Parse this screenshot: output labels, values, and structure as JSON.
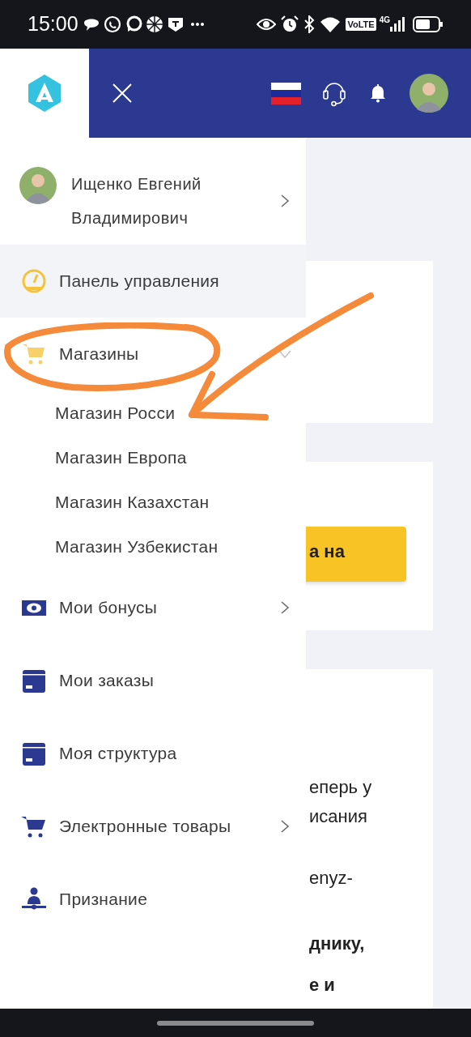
{
  "status_bar": {
    "time": "15:00",
    "volte": "VoLTE",
    "network": "4G"
  },
  "user": {
    "name": "Ищенко Евгений Владимирович",
    "has_submenu": true
  },
  "menu": [
    {
      "label": "Панель управления",
      "selected": true,
      "has_submenu": false
    },
    {
      "label": "Магазины",
      "selected": false,
      "has_submenu": true,
      "expanded": true,
      "children": [
        {
          "label": "Магазин Росси"
        },
        {
          "label": "Магазин Европа"
        },
        {
          "label": "Магазин Казахстан"
        },
        {
          "label": "Магазин Узбекистан"
        }
      ]
    },
    {
      "label": "Мои бонусы",
      "selected": false,
      "has_submenu": true,
      "expanded": false
    },
    {
      "label": "Мои заказы",
      "selected": false,
      "has_submenu": false
    },
    {
      "label": "Моя структура",
      "selected": false,
      "has_submenu": false
    },
    {
      "label": "Электронные товары",
      "selected": false,
      "has_submenu": true,
      "expanded": false
    },
    {
      "label": "Признание",
      "selected": false,
      "has_submenu": false
    }
  ],
  "content": {
    "button_text": "а на",
    "lines": [
      {
        "text": "еперь у",
        "bold": false
      },
      {
        "text": "исания",
        "bold": false
      },
      {
        "text": "enyz-",
        "bold": false
      },
      {
        "text": "днику,",
        "bold": true
      },
      {
        "text": "е и",
        "bold": true
      }
    ]
  }
}
